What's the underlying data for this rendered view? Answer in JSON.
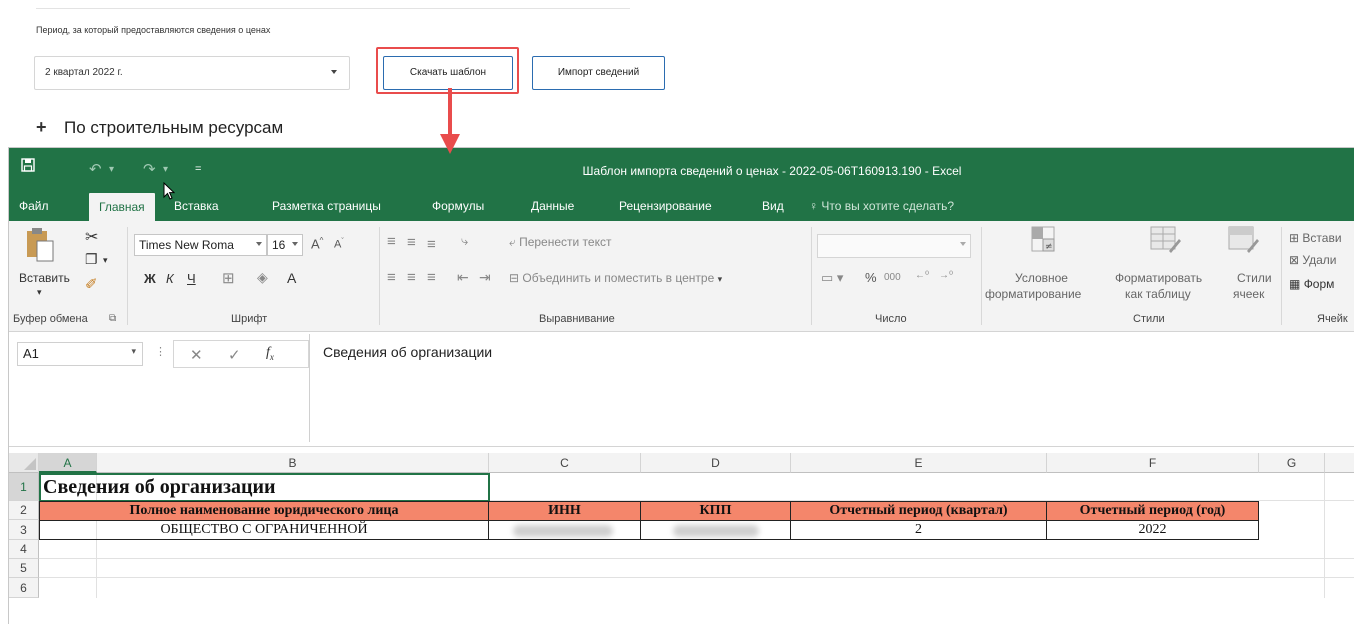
{
  "portal": {
    "period_label": "Период, за который предоставляются сведения о ценах",
    "period_value": "2 квартал 2022 г.",
    "download_button": "Скачать шаблон",
    "import_button": "Импорт сведений",
    "section_title": "По строительным ресурсам",
    "highlight_color": "#e94c4c"
  },
  "excel": {
    "window_title": "Шаблон импорта сведений о ценах - 2022-05-06T160913.190 - Excel",
    "accent_color": "#217346",
    "tabs": [
      "Файл",
      "Главная",
      "Вставка",
      "Разметка страницы",
      "Формулы",
      "Данные",
      "Рецензирование",
      "Вид"
    ],
    "tell_me": "Что вы хотите сделать?",
    "ribbon": {
      "paste": "Вставить",
      "clipboard": "Буфер обмена",
      "font_name": "Times New Roma",
      "font_size": "16",
      "font_group": "Шрифт",
      "wrap_text": "Перенести текст",
      "merge_center": "Объединить и поместить в центре",
      "alignment_group": "Выравнивание",
      "number_group": "Число",
      "conditional_line1": "Условное",
      "conditional_line2": "форматирование",
      "format_table_line1": "Форматировать",
      "format_table_line2": "как таблицу",
      "cell_styles_line1": "Стили",
      "cell_styles_line2": "ячеек",
      "styles_group": "Стили",
      "insert_cut": "Встави",
      "delete_cut": "Удали",
      "format_cut": "Форм",
      "cells_cut": "Ячейк",
      "bold": "Ж",
      "italic": "К",
      "underline": "Ч",
      "percent": "%",
      "thousands": "000"
    },
    "name_box": "A1",
    "formula": "Сведения об организации",
    "columns": [
      "A",
      "B",
      "C",
      "D",
      "E",
      "F",
      "G"
    ],
    "rows": [
      "1",
      "2",
      "3",
      "4",
      "5",
      "6"
    ],
    "sheet": {
      "title": "Сведения об организации",
      "headers": [
        "Полное наименование юридического лица",
        "ИНН",
        "КПП",
        "Отчетный период (квартал)",
        "Отчетный период (год)"
      ],
      "row3": {
        "name": "ОБЩЕСТВО С ОГРАНИЧЕННОЙ",
        "quarter": "2",
        "year": "2022"
      },
      "header_fill": "#f4866b"
    }
  }
}
